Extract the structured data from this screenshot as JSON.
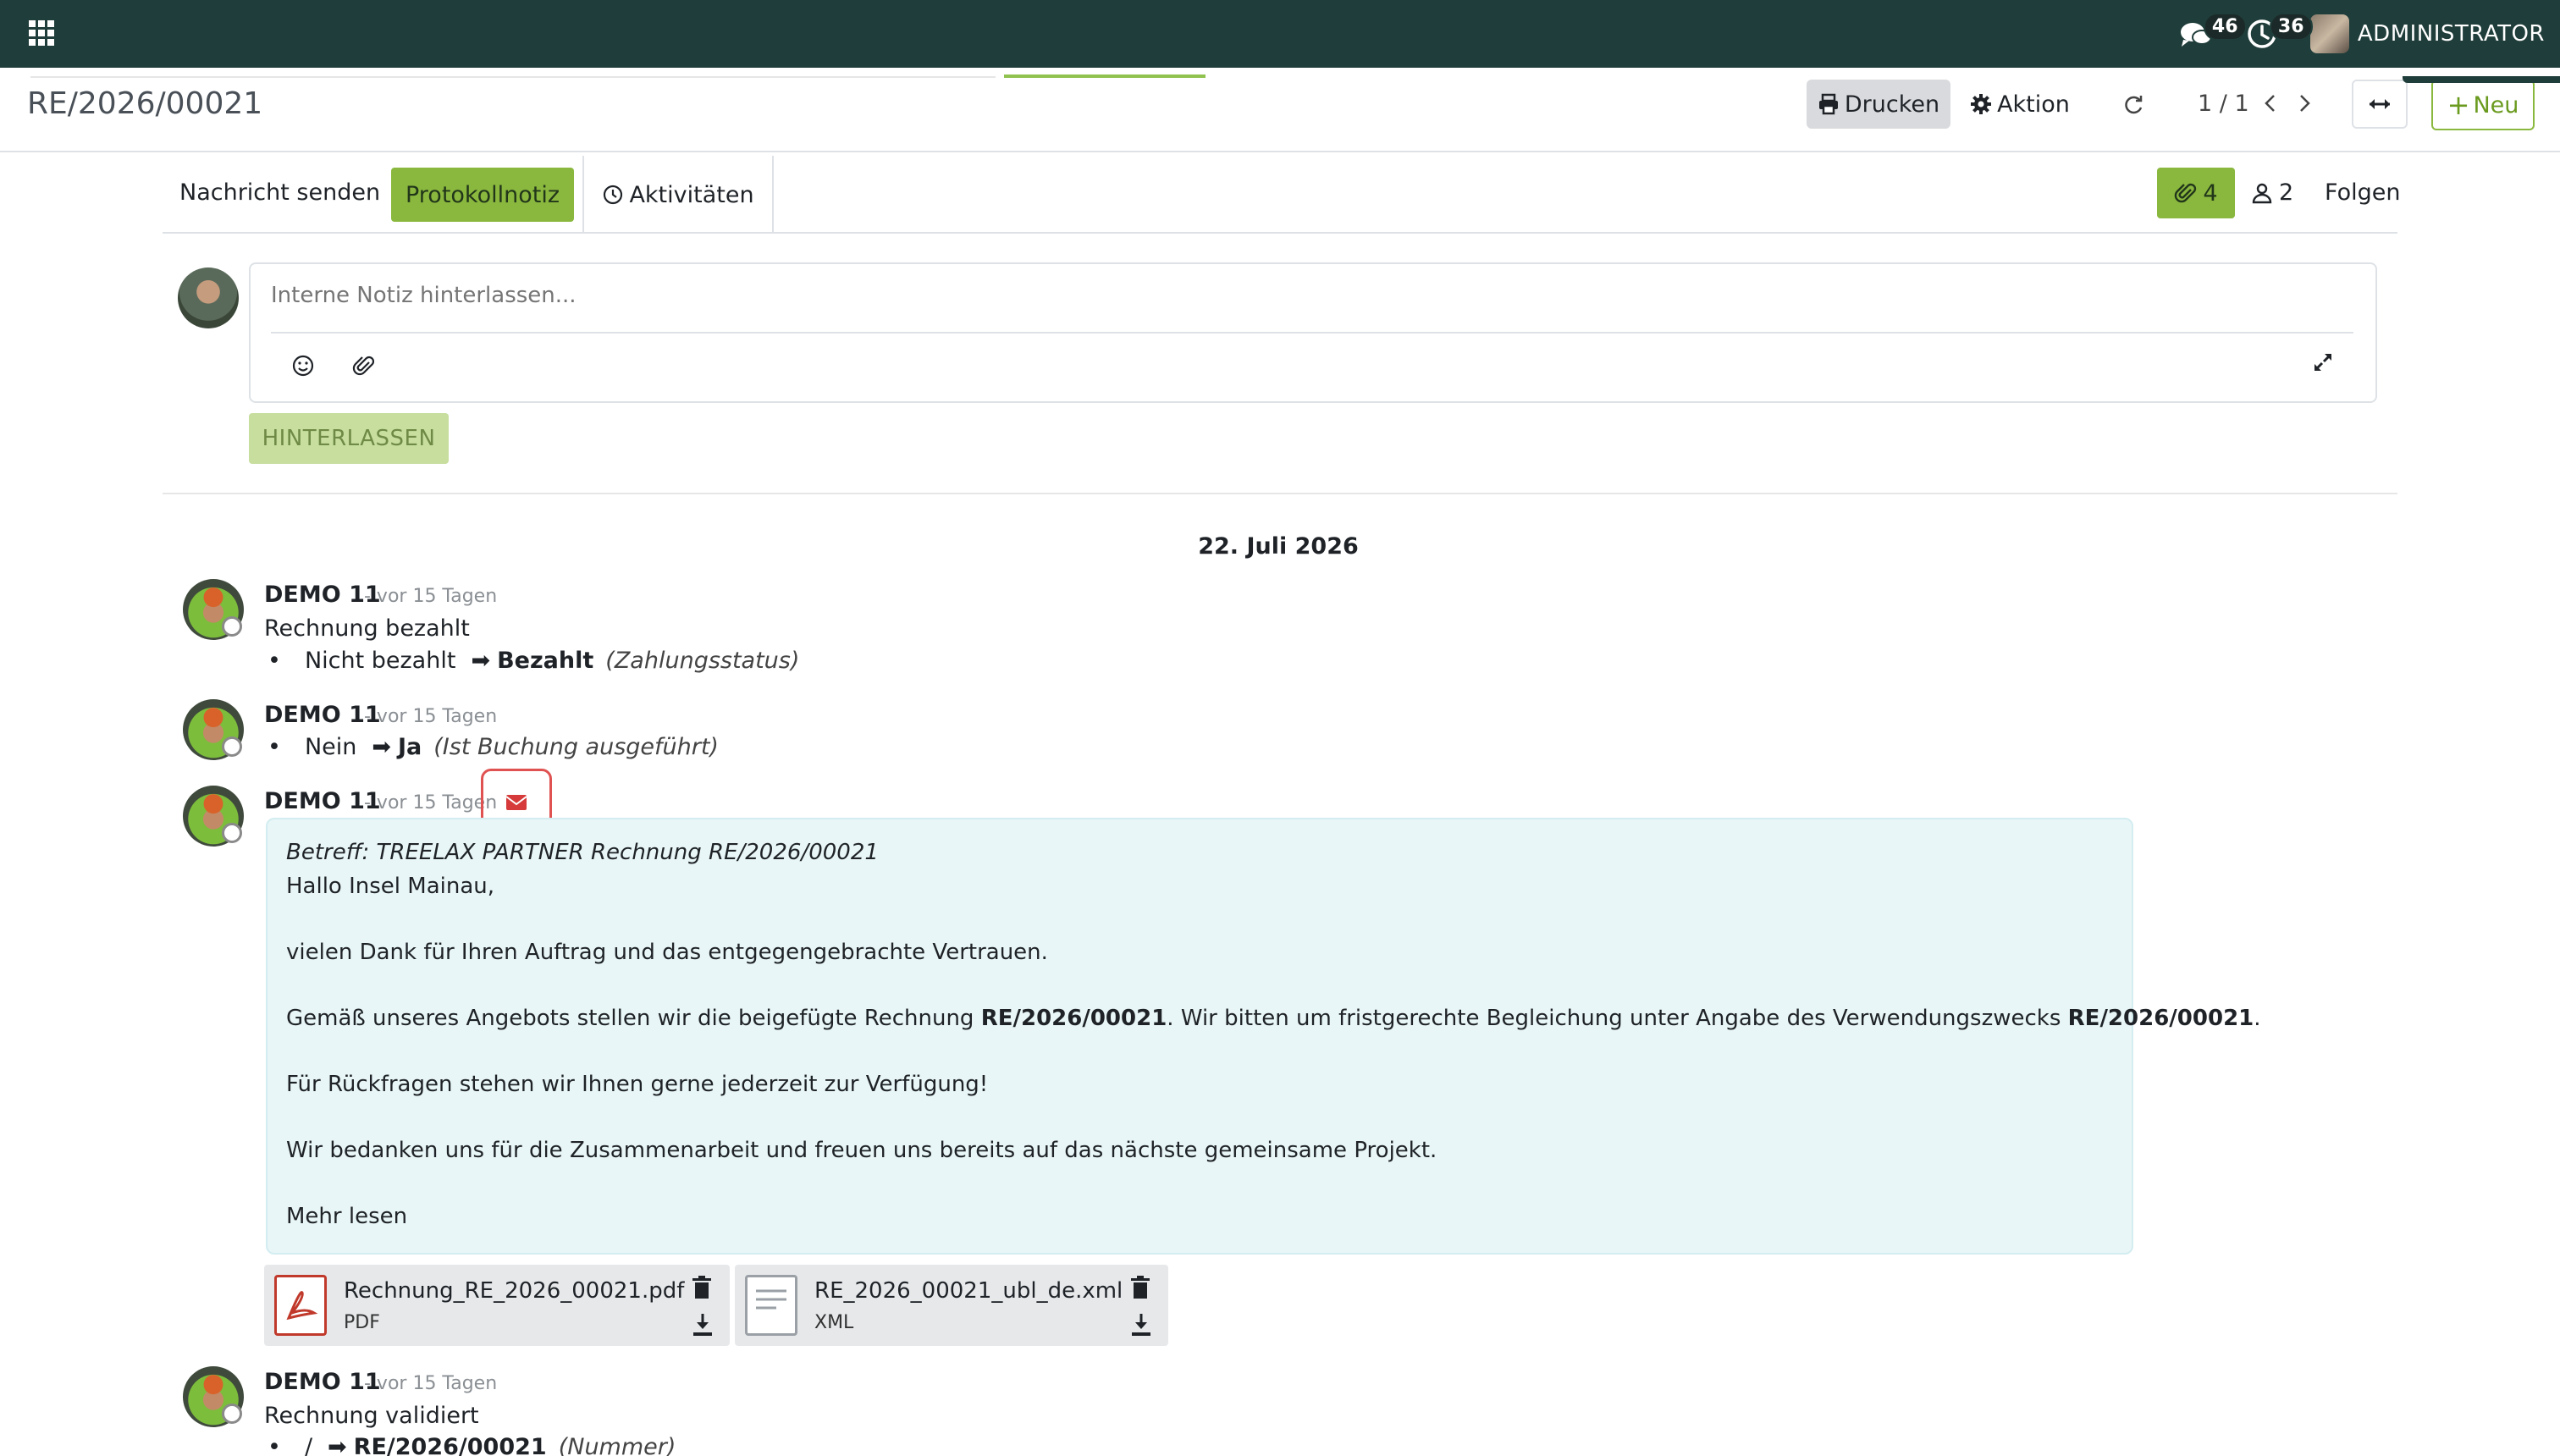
{
  "topnav": {
    "messages_badge": "46",
    "activities_badge": "36",
    "user_name": "ADMINISTRATOR"
  },
  "control_panel": {
    "breadcrumb": "RE/2026/00021",
    "print_label": "Drucken",
    "action_label": "Aktion",
    "pager": "1 / 1",
    "new_label": "Neu"
  },
  "chatter": {
    "tabs": {
      "send_message": "Nachricht senden",
      "log_note": "Protokollnotiz",
      "activities": "Aktivitäten"
    },
    "attachment_count": "4",
    "follower_count": "2",
    "follow_label": "Folgen",
    "composer": {
      "placeholder": "Interne Notiz hinterlassen...",
      "submit_label": "HINTERLASSEN"
    },
    "date_separator": "22. Juli 2026",
    "messages": [
      {
        "author": "DEMO 11",
        "ago": "- vor 15 Tagen",
        "text": "Rechnung bezahlt",
        "tracking": {
          "old": "Nicht bezahlt",
          "new": "Bezahlt",
          "field": "(Zahlungsstatus)"
        }
      },
      {
        "author": "DEMO 11",
        "ago": "- vor 15 Tagen",
        "tracking": {
          "old": "Nein",
          "new": "Ja",
          "field": "(Ist Buchung ausgeführt)"
        }
      },
      {
        "author": "DEMO 11",
        "ago": "- vor 15 Tagen",
        "email": {
          "subject": "Betreff: TREELAX PARTNER Rechnung RE/2026/00021",
          "greeting": "Hallo Insel Mainau,",
          "p1": "vielen Dank für Ihren Auftrag und das entgegengebrachte Vertrauen.",
          "p2_a": "Gemäß unseres Angebots stellen wir die beigefügte Rechnung ",
          "p2_ref1": "RE/2026/00021",
          "p2_b": ". Wir bitten um fristgerechte Begleichung unter Angabe des Verwendungszwecks ",
          "p2_ref2": "RE/2026/00021",
          "p2_c": ".",
          "p3": "Für Rückfragen stehen wir Ihnen gerne jederzeit zur Verfügung!",
          "p4": "Wir bedanken uns für die Zusammenarbeit und freuen uns bereits auf das nächste gemeinsame Projekt.",
          "read_more": "Mehr lesen"
        },
        "attachments": [
          {
            "name": "Rechnung_RE_2026_00021.pdf",
            "type": "PDF"
          },
          {
            "name": "RE_2026_00021_ubl_de.xml",
            "type": "XML"
          }
        ]
      },
      {
        "author": "DEMO 11",
        "ago": "- vor 15 Tagen",
        "text": "Rechnung validiert",
        "tracking": {
          "old": "/",
          "new": "RE/2026/00021",
          "field": "(Nummer)"
        }
      }
    ]
  },
  "colors": {
    "topnav": "#1f3d3a",
    "accent_green": "#8ab83e",
    "mail_bg": "#e8f6f8",
    "highlight_red": "#e05252"
  }
}
